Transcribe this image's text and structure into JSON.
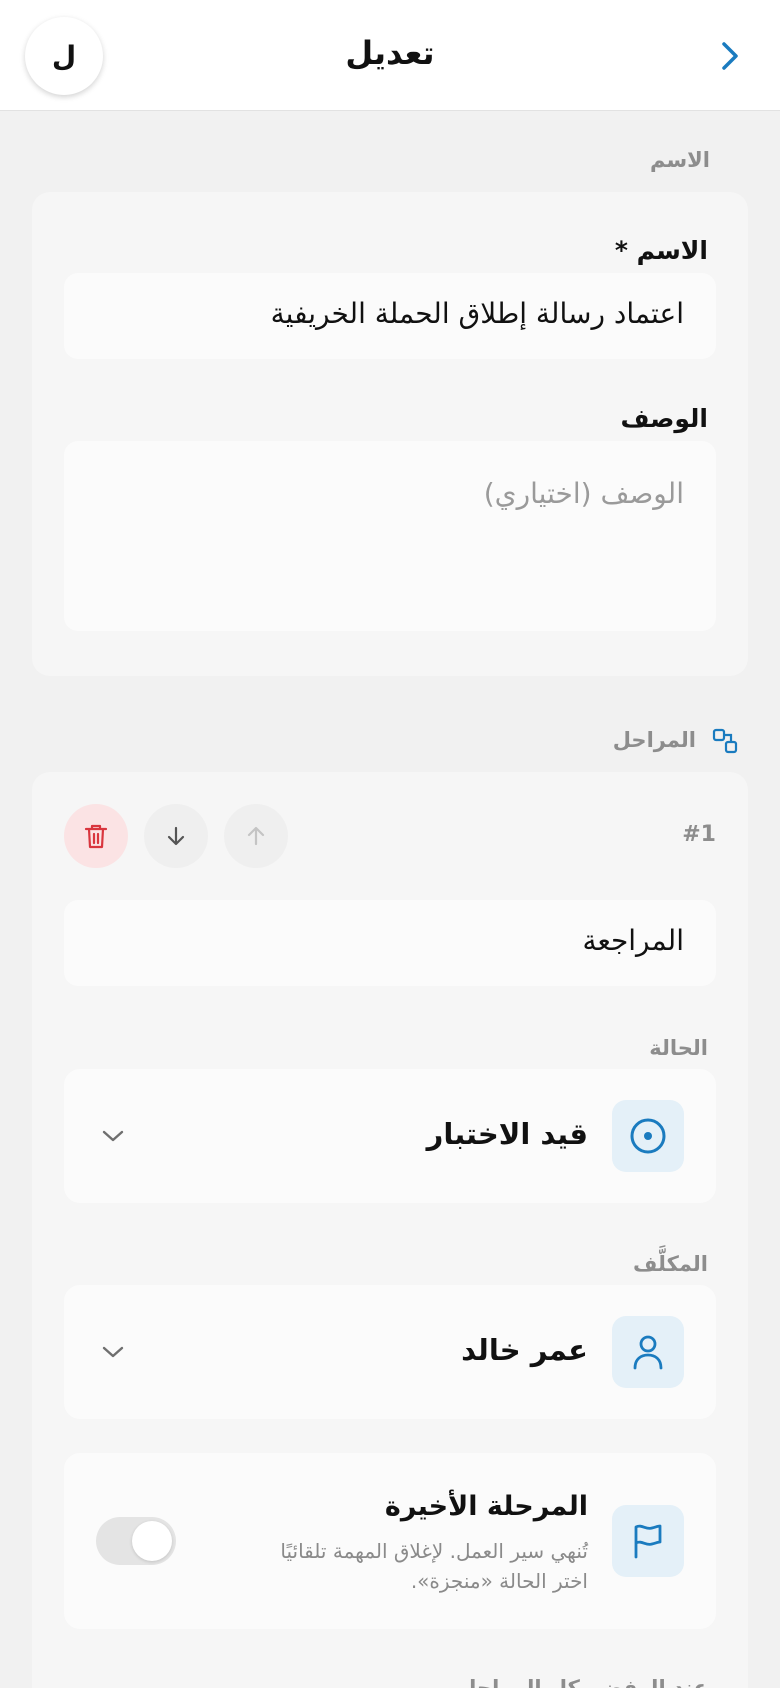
{
  "header": {
    "title": "تعديل",
    "avatar_initial": "ل"
  },
  "name_section": {
    "label": "الاسم",
    "name_field": {
      "label": "الاسم *",
      "value": "اعتماد رسالة إطلاق الحملة الخريفية"
    },
    "description_field": {
      "label": "الوصف",
      "placeholder": "الوصف (اختياري)"
    }
  },
  "stages_section": {
    "label": "المراحل",
    "stage": {
      "number": "#1",
      "name": "المراجعة",
      "status_label": "الحالة",
      "status_value": "قيد الاختبار",
      "assignee_label": "المكلَّف",
      "assignee_value": "عمر خالد",
      "final_stage": {
        "title": "المرحلة الأخيرة",
        "description_line1": "تُنهي سير العمل. لإغلاق المهمة تلقائيًا",
        "description_line2": "اختر الحالة «منجزة».",
        "enabled": false
      },
      "next_label": "عند الرفض، كل المراحل"
    }
  },
  "colors": {
    "accent": "#1a7bbf",
    "danger": "#d9363e",
    "danger_bg": "#fbe3e4",
    "tile_bg": "#e4f0f8"
  }
}
